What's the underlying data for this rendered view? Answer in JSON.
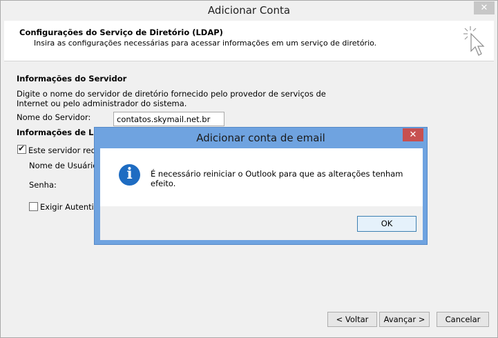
{
  "window": {
    "title": "Adicionar Conta",
    "close_glyph": "✕"
  },
  "header": {
    "title": "Configurações do Serviço de Diretório (LDAP)",
    "description": "Insira as configurações necessárias para acessar informações em um serviço de diretório.",
    "icon": "cursor-sparkle-icon"
  },
  "server_section": {
    "heading": "Informações do Servidor",
    "description": "Digite o nome do servidor de diretório fornecido pelo provedor de serviços de Internet ou pelo administrador do sistema.",
    "server_label": "Nome do Servidor:",
    "server_value": "contatos.skymail.net.br"
  },
  "logon_section": {
    "heading": "Informações de Logon",
    "requires_logon_label": "Este servidor requer que eu faça logon",
    "requires_logon_checked": true,
    "username_label": "Nome de Usuário:",
    "password_label": "Senha:",
    "spa_label": "Exigir Autenticação de Senha Segura (SPA)",
    "spa_checked": false
  },
  "footer": {
    "back_label": "< Voltar",
    "next_label": "Avançar >",
    "cancel_label": "Cancelar"
  },
  "dialog": {
    "title": "Adicionar conta de email",
    "close_glyph": "✕",
    "icon": "info-icon",
    "message": "É necessário reiniciar o Outlook para que as alterações tenham efeito.",
    "ok_label": "OK"
  },
  "colors": {
    "dialog_frame": "#6fa3e0",
    "dialog_close": "#c75050",
    "info_icon": "#1e6cc2"
  }
}
